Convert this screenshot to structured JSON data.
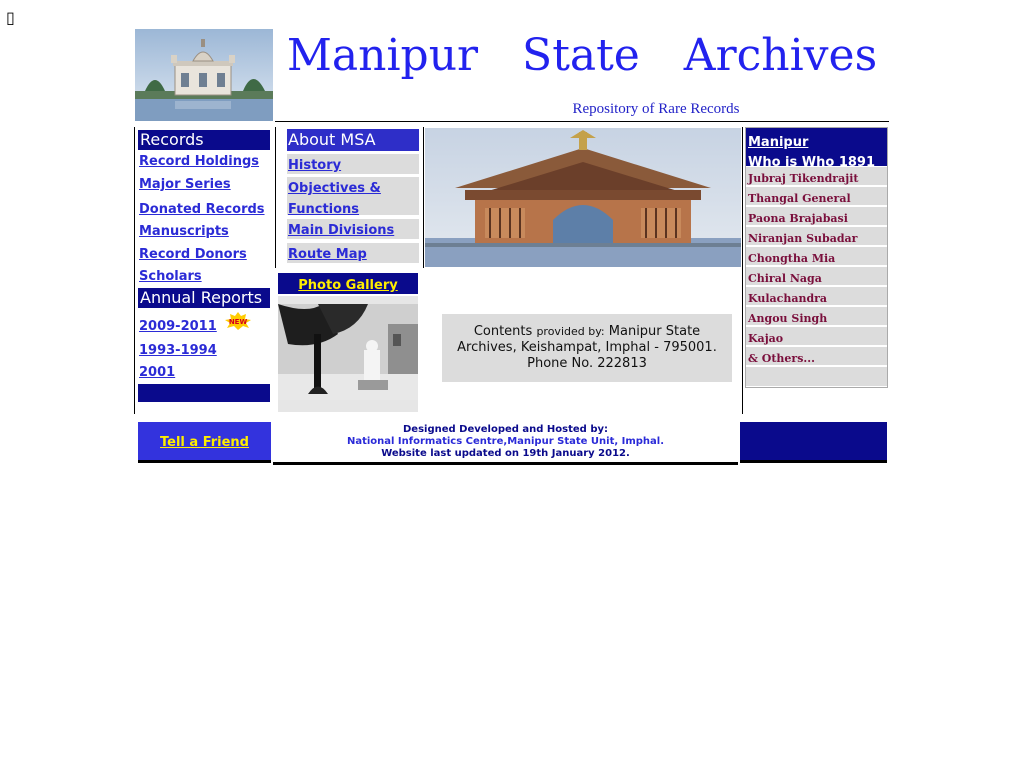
{
  "corner_glyph": "▯",
  "header": {
    "title": "Manipur State Archives",
    "subtitle": "Repository of Rare Records",
    "logo_icon": "palace-pavilion-image"
  },
  "left_menu": {
    "records_heading": "Records",
    "records_items": [
      "Record Holdings",
      "Major Series",
      "Donated Records",
      "Manuscripts",
      "Record Donors",
      "Scholars"
    ],
    "annual_heading": "Annual Reports",
    "annual_items": [
      "2009-2011",
      "1993-1994",
      "2001"
    ],
    "new_badge": "NEW"
  },
  "about_menu": {
    "heading": "About MSA",
    "items": [
      "History",
      "Objectives & Functions",
      "Main Divisions",
      "Route Map"
    ]
  },
  "gallery": {
    "label": "Photo Gallery",
    "photo_icon": "tree-and-statue-photo"
  },
  "banner": {
    "icon": "archway-gate-painting"
  },
  "contents": {
    "lead": "Contents",
    "small": "provided by:",
    "text": "Manipur State Archives, Keishampat, Imphal - 795001. Phone No. 222813"
  },
  "who_is_who": {
    "heading_line1": "Manipur",
    "heading_line2": "Who is Who 1891",
    "items": [
      "Jubraj Tikendrajit",
      "Thangal General",
      "Paona Brajabasi",
      "Niranjan Subadar",
      "Chongtha Mia",
      "Chiral Naga",
      "Kulachandra",
      "Angou Singh",
      "Kajao",
      "& Others..."
    ]
  },
  "footer": {
    "tell_friend": "Tell a Friend",
    "line1": "Designed Developed and Hosted by:",
    "line2": "National Informatics Centre,Manipur State Unit, Imphal.",
    "line3": "Website last updated on 19th January 2012."
  },
  "colors": {
    "navy": "#0a0a8c",
    "link_blue": "#2b2bd6",
    "title_blue": "#2222ee",
    "maroon": "#7a0f3c",
    "gold": "#ffee00"
  }
}
